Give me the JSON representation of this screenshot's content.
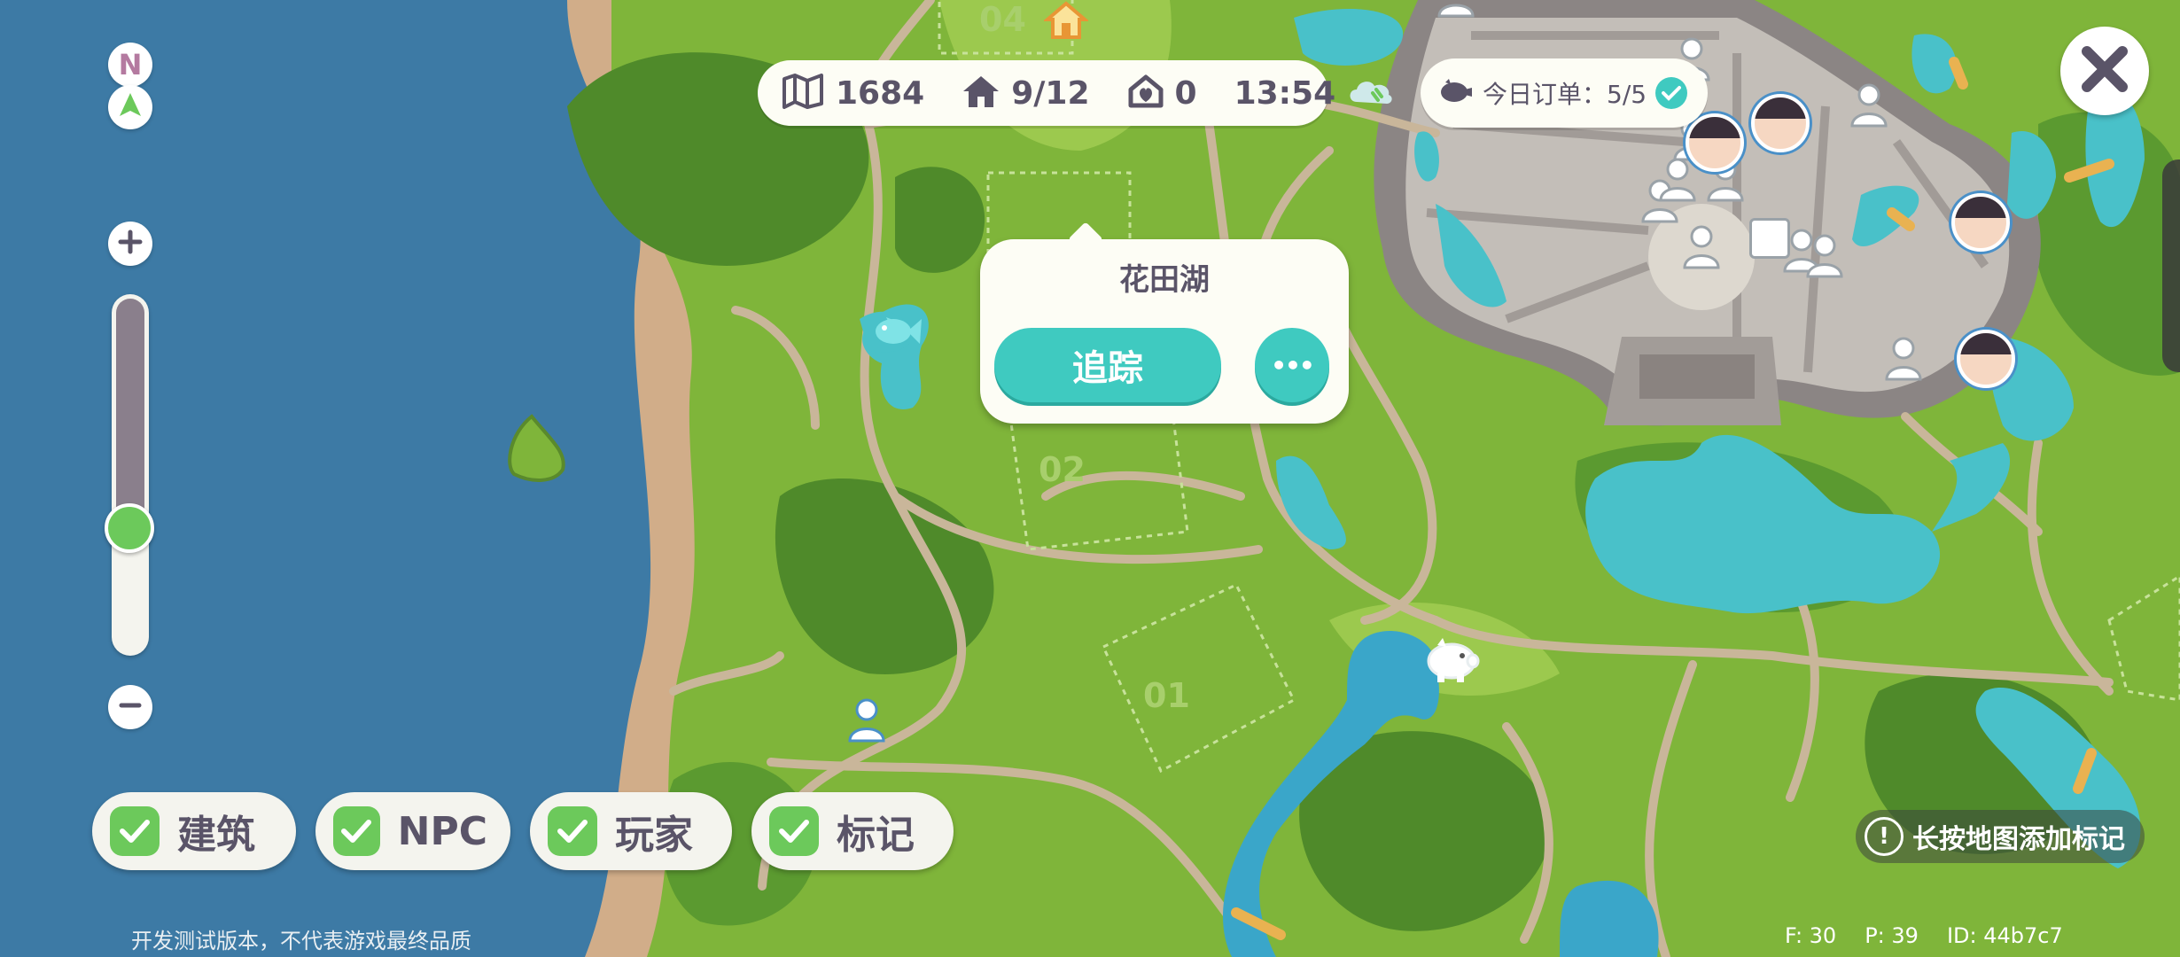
{
  "hud": {
    "area": "1684",
    "houses": "9/12",
    "homes": "0",
    "time": "13:54"
  },
  "orders": {
    "label": "今日订单：5/5"
  },
  "popup": {
    "title": "花田湖",
    "track_label": "追踪",
    "more_label": "•••"
  },
  "compass": {
    "letter": "N"
  },
  "zoom": {
    "level": 0.3
  },
  "filters": [
    {
      "label": "建筑",
      "checked": true
    },
    {
      "label": "NPC",
      "checked": true
    },
    {
      "label": "玩家",
      "checked": true
    },
    {
      "label": "标记",
      "checked": true
    }
  ],
  "hint": {
    "text": "长按地图添加标记"
  },
  "plots": [
    "04",
    "02",
    "01"
  ],
  "footer": {
    "disclaimer": "开发测试版本，不代表游戏最终品质",
    "f": "F: 30",
    "p": "P: 39",
    "id": "ID: 44b7c7"
  },
  "colors": {
    "sea": "#3d7aa5",
    "grass": "#7fb53a",
    "accent": "#3fcac0",
    "check": "#6cc95b"
  }
}
